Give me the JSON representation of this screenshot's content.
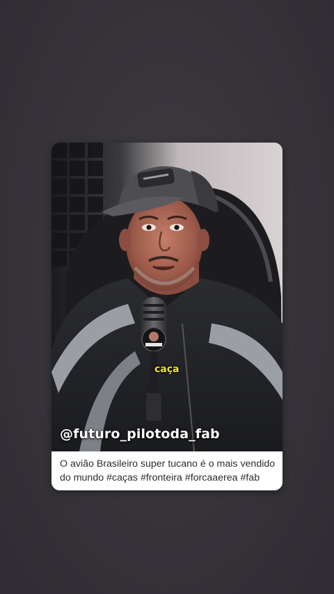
{
  "post": {
    "video_sticker": "caça",
    "author_handle": "@futuro_pilotoda_fab",
    "caption": "O avião Brasileiro super tucano é o mais vendido do mundo #caças #fronteira #forcaaerea #fab"
  },
  "colors": {
    "background": "#37353a",
    "card_caption_bg": "#ffffff",
    "sticker_text": "#f2e233",
    "handle_text": "#ffffff"
  },
  "icons": {
    "mic_logo": "podcast-mic-logo"
  }
}
